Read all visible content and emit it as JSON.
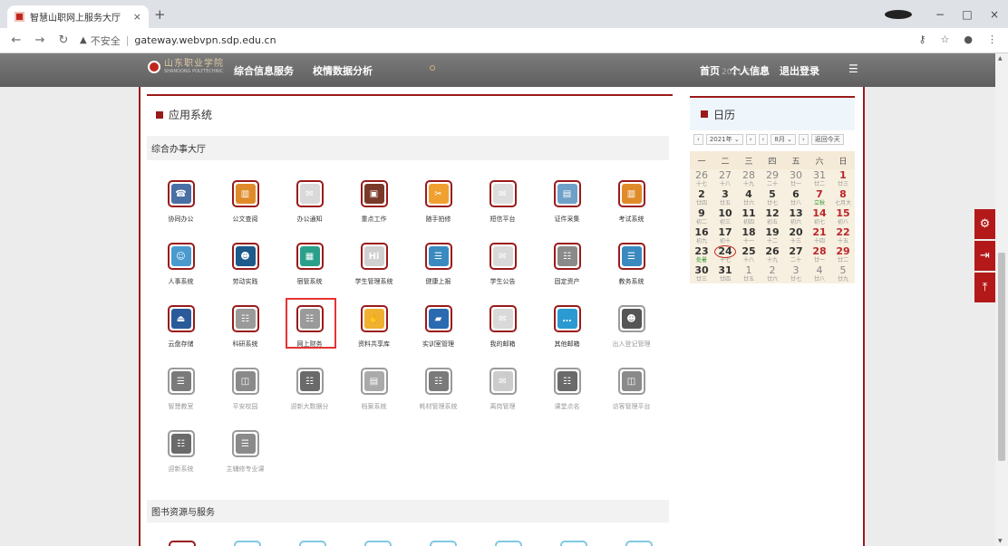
{
  "browser": {
    "tab_title": "智慧山职网上服务大厅",
    "tab_close": "×",
    "new_tab": "+",
    "url_warning": "不安全",
    "url": "gateway.webvpn.sdp.edu.cn",
    "win_min": "−",
    "win_max": "□",
    "win_close": "×"
  },
  "header": {
    "logo_text": "山东职业学院",
    "logo_sub": "SHANDONG POLYTECHNIC",
    "nav": [
      "综合信息服务",
      "校情数据分析"
    ],
    "right_nav": [
      "首页",
      "个人信息",
      "退出登录"
    ],
    "overlay_text": "2021年  日历"
  },
  "apps_section": {
    "title": "应用系统",
    "subsection": "综合办事大厅",
    "highlight_color": "#e53333",
    "apps": [
      {
        "label": "协同办公",
        "icon": "phone-doc-icon",
        "color": "#4a6fa5",
        "glyph": "☎"
      },
      {
        "label": "公文查阅",
        "icon": "bar-chart-icon",
        "color": "#e08b2a",
        "glyph": "▥"
      },
      {
        "label": "办公通知",
        "icon": "envelope-icon",
        "color": "#d9d9d9",
        "glyph": "✉"
      },
      {
        "label": "重点工作",
        "icon": "briefcase-icon",
        "color": "#7a3a2a",
        "glyph": "▣"
      },
      {
        "label": "随手拍修",
        "icon": "wrench-icon",
        "color": "#f0a030",
        "glyph": "✂"
      },
      {
        "label": "短信平台",
        "icon": "mail-icon",
        "color": "#dddddd",
        "glyph": "✉"
      },
      {
        "label": "证件采集",
        "icon": "id-card-icon",
        "color": "#6fa0c8",
        "glyph": "▤"
      },
      {
        "label": "考试系统",
        "icon": "bar-chart-icon",
        "color": "#e08b2a",
        "glyph": "▥"
      },
      {
        "label": "人事系统",
        "icon": "person-icon",
        "color": "#4a9ad0",
        "glyph": "☺"
      },
      {
        "label": "劳动实践",
        "icon": "user-clock-icon",
        "color": "#1d5a8a",
        "glyph": "☻"
      },
      {
        "label": "宿管系统",
        "icon": "building-icon",
        "color": "#2aa08a",
        "glyph": "▦"
      },
      {
        "label": "学生管理系统",
        "icon": "hi-icon",
        "color": "#d0d0d0",
        "glyph": "Hi"
      },
      {
        "label": "健康上报",
        "icon": "list-doc-icon",
        "color": "#3a8ac0",
        "glyph": "☰"
      },
      {
        "label": "学生公告",
        "icon": "envelope-icon",
        "color": "#d9d9d9",
        "glyph": "✉"
      },
      {
        "label": "固定资产",
        "icon": "server-icon",
        "color": "#8a8a8a",
        "glyph": "☷"
      },
      {
        "label": "教务系统",
        "icon": "list-doc-icon",
        "color": "#3a8ac0",
        "glyph": "☰"
      },
      {
        "label": "云盘存储",
        "icon": "drive-icon",
        "color": "#2a5a9a",
        "glyph": "⏏"
      },
      {
        "label": "科研系统",
        "icon": "server-icon",
        "color": "#9a9a9a",
        "glyph": "☷"
      },
      {
        "label": "网上财务",
        "icon": "server-icon",
        "color": "#9a9a9a",
        "glyph": "☷"
      },
      {
        "label": "资料共享库",
        "icon": "hand-book-icon",
        "color": "#f0b030",
        "glyph": "✋"
      },
      {
        "label": "实训室管理",
        "icon": "folder-icon",
        "color": "#2a6ab0",
        "glyph": "▰"
      },
      {
        "label": "我的邮箱",
        "icon": "envelope-icon",
        "color": "#d9d9d9",
        "glyph": "✉"
      },
      {
        "label": "其他邮箱",
        "icon": "chat-icon",
        "color": "#2a9ad0",
        "glyph": "…"
      },
      {
        "label": "出入登记管理",
        "icon": "user-clock-icon",
        "color": "#555555",
        "glyph": "☻"
      },
      {
        "label": "智慧教室",
        "icon": "list-doc-icon",
        "color": "#7a7a7a",
        "glyph": "☰"
      },
      {
        "label": "平安校园",
        "icon": "camera-icon",
        "color": "#8a8a8a",
        "glyph": "◫"
      },
      {
        "label": "迎新大数据分",
        "icon": "server-icon",
        "color": "#6a6a6a",
        "glyph": "☷"
      },
      {
        "label": "档案系统",
        "icon": "chart-doc-icon",
        "color": "#aaaaaa",
        "glyph": "▤"
      },
      {
        "label": "耗材管理系统",
        "icon": "server-icon",
        "color": "#7a7a7a",
        "glyph": "☷"
      },
      {
        "label": "离岗管理",
        "icon": "envelope-icon",
        "color": "#cccccc",
        "glyph": "✉"
      },
      {
        "label": "课堂点名",
        "icon": "server-icon",
        "color": "#6a6a6a",
        "glyph": "☷"
      },
      {
        "label": "访客管理平台",
        "icon": "camera-icon",
        "color": "#8a8a8a",
        "glyph": "◫"
      },
      {
        "label": "迎新系统",
        "icon": "server-icon",
        "color": "#6a6a6a",
        "glyph": "☷"
      },
      {
        "label": "主辅修专业课",
        "icon": "list-doc-icon",
        "color": "#8a8a8a",
        "glyph": "☰"
      }
    ]
  },
  "books_section": {
    "title": "图书资源与服务"
  },
  "calendar": {
    "title": "日历",
    "year_label": "2021年",
    "month_label": "8月",
    "today_button": "返回今天",
    "weekdays": [
      "一",
      "二",
      "三",
      "四",
      "五",
      "六",
      "日"
    ],
    "weeks": [
      [
        {
          "d": "26",
          "l": "十七",
          "o": 1
        },
        {
          "d": "27",
          "l": "十八",
          "o": 1
        },
        {
          "d": "28",
          "l": "十九",
          "o": 1
        },
        {
          "d": "29",
          "l": "二十",
          "o": 1
        },
        {
          "d": "30",
          "l": "廿一",
          "o": 1
        },
        {
          "d": "31",
          "l": "廿二",
          "o": 1,
          "w": 1
        },
        {
          "d": "1",
          "l": "廿三",
          "w": 1
        }
      ],
      [
        {
          "d": "2",
          "l": "廿四"
        },
        {
          "d": "3",
          "l": "廿五"
        },
        {
          "d": "4",
          "l": "廿六"
        },
        {
          "d": "5",
          "l": "廿七"
        },
        {
          "d": "6",
          "l": "廿八"
        },
        {
          "d": "7",
          "l": "立秋",
          "w": 1,
          "f": 1
        },
        {
          "d": "8",
          "l": "七月大",
          "w": 1
        }
      ],
      [
        {
          "d": "9",
          "l": "初二"
        },
        {
          "d": "10",
          "l": "初三"
        },
        {
          "d": "11",
          "l": "初四"
        },
        {
          "d": "12",
          "l": "初五"
        },
        {
          "d": "13",
          "l": "初六"
        },
        {
          "d": "14",
          "l": "初七",
          "w": 1
        },
        {
          "d": "15",
          "l": "初八",
          "w": 1
        }
      ],
      [
        {
          "d": "16",
          "l": "初九"
        },
        {
          "d": "17",
          "l": "初十"
        },
        {
          "d": "18",
          "l": "十一"
        },
        {
          "d": "19",
          "l": "十二"
        },
        {
          "d": "20",
          "l": "十三"
        },
        {
          "d": "21",
          "l": "十四",
          "w": 1
        },
        {
          "d": "22",
          "l": "十五",
          "w": 1
        }
      ],
      [
        {
          "d": "23",
          "l": "处暑",
          "f": 1
        },
        {
          "d": "24",
          "l": "十七",
          "t": 1
        },
        {
          "d": "25",
          "l": "十八"
        },
        {
          "d": "26",
          "l": "十九"
        },
        {
          "d": "27",
          "l": "二十"
        },
        {
          "d": "28",
          "l": "廿一",
          "w": 1
        },
        {
          "d": "29",
          "l": "廿二",
          "w": 1
        }
      ],
      [
        {
          "d": "30",
          "l": "廿三"
        },
        {
          "d": "31",
          "l": "廿四"
        },
        {
          "d": "1",
          "l": "廿五",
          "o": 1
        },
        {
          "d": "2",
          "l": "廿六",
          "o": 1
        },
        {
          "d": "3",
          "l": "廿七",
          "o": 1
        },
        {
          "d": "4",
          "l": "廿八",
          "o": 1,
          "w": 1
        },
        {
          "d": "5",
          "l": "廿九",
          "o": 1,
          "w": 1
        }
      ]
    ]
  }
}
